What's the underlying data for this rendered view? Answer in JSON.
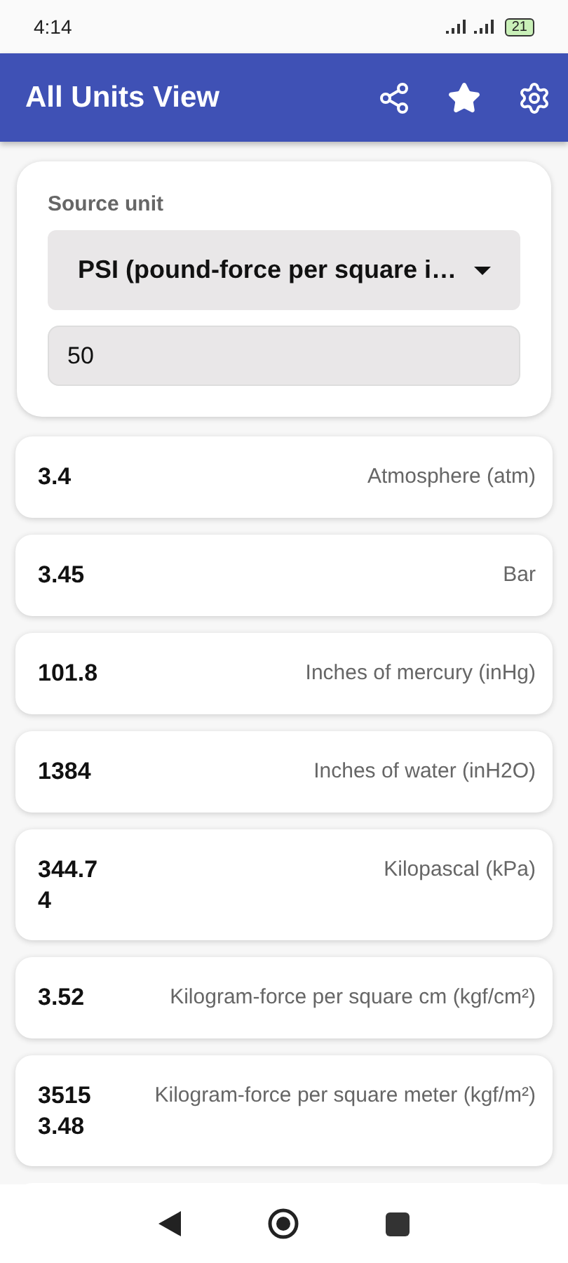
{
  "status_bar": {
    "time": "4:14",
    "battery": "21"
  },
  "app_bar": {
    "title": "All Units View"
  },
  "source": {
    "label": "Source unit",
    "unit": "PSI (pound-force per square i…",
    "value": "50"
  },
  "results": [
    {
      "value": "3.4",
      "unit": "Atmosphere (atm)"
    },
    {
      "value": "3.45",
      "unit": "Bar"
    },
    {
      "value": "101.8",
      "unit": "Inches of mercury (inHg)"
    },
    {
      "value": "1384",
      "unit": "Inches of water (inH2O)"
    },
    {
      "value": "344.74",
      "unit": "Kilopascal (kPa)"
    },
    {
      "value": "3.52",
      "unit": "Kilogram-force per square cm (kgf/cm²)"
    },
    {
      "value": "35153.48",
      "unit": "Kilogram-force per square meter (kgf/m²)"
    }
  ]
}
